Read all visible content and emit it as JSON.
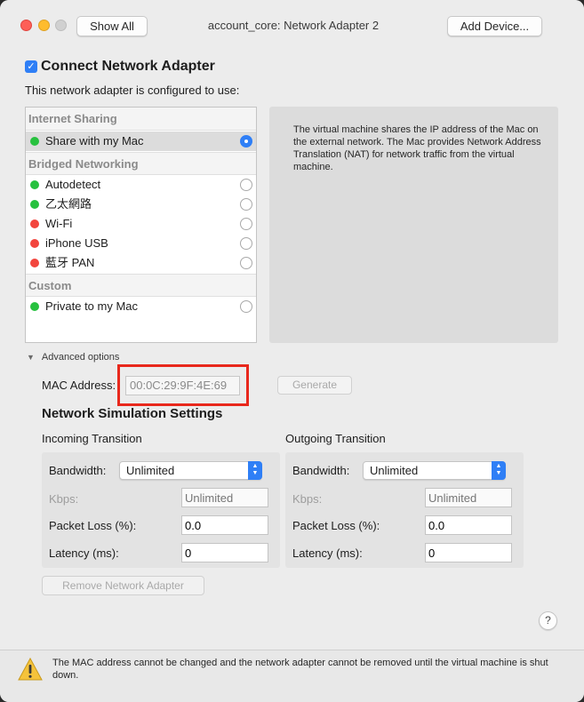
{
  "window": {
    "title": "account_core: Network Adapter 2",
    "show_all_label": "Show All",
    "add_device_label": "Add Device..."
  },
  "connect": {
    "checkbox_checked": true,
    "label": "Connect Network Adapter",
    "config_text": "This network adapter is configured to use:"
  },
  "network_list": {
    "sections": [
      {
        "header": "Internet Sharing",
        "items": [
          {
            "label": "Share with my Mac",
            "status": "green",
            "selected": true
          }
        ]
      },
      {
        "header": "Bridged Networking",
        "items": [
          {
            "label": "Autodetect",
            "status": "green",
            "selected": false
          },
          {
            "label": "乙太網路",
            "status": "green",
            "selected": false
          },
          {
            "label": "Wi-Fi",
            "status": "red",
            "selected": false
          },
          {
            "label": "iPhone USB",
            "status": "red",
            "selected": false
          },
          {
            "label": "藍牙 PAN",
            "status": "red",
            "selected": false
          }
        ]
      },
      {
        "header": "Custom",
        "items": [
          {
            "label": "Private to my Mac",
            "status": "green",
            "selected": false
          }
        ]
      }
    ],
    "description": "The virtual machine shares the IP address of the Mac on the external network. The Mac provides Network Address Translation (NAT) for network traffic from the virtual machine."
  },
  "advanced": {
    "toggle_label": "Advanced options",
    "mac_label": "MAC Address:",
    "mac_value": "00:0C:29:9F:4E:69",
    "generate_label": "Generate"
  },
  "simulation": {
    "title": "Network Simulation Settings",
    "incoming": {
      "title": "Incoming Transition",
      "bandwidth_label": "Bandwidth:",
      "bandwidth_value": "Unlimited",
      "kbps_label": "Kbps:",
      "kbps_placeholder": "Unlimited",
      "packet_loss_label": "Packet Loss (%):",
      "packet_loss_value": "0.0",
      "latency_label": "Latency (ms):",
      "latency_value": "0"
    },
    "outgoing": {
      "title": "Outgoing Transition",
      "bandwidth_label": "Bandwidth:",
      "bandwidth_value": "Unlimited",
      "kbps_label": "Kbps:",
      "kbps_placeholder": "Unlimited",
      "packet_loss_label": "Packet Loss (%):",
      "packet_loss_value": "0.0",
      "latency_label": "Latency (ms):",
      "latency_value": "0"
    }
  },
  "remove_label": "Remove Network Adapter",
  "help_label": "?",
  "warning": {
    "icon": "warning-icon",
    "text": "The MAC address cannot be changed and the network adapter cannot be removed until the virtual machine is shut down."
  },
  "colors": {
    "accent": "#2f7ff6",
    "status_green": "#27c13f",
    "status_red": "#f2453d",
    "highlight": "#e8281c"
  }
}
